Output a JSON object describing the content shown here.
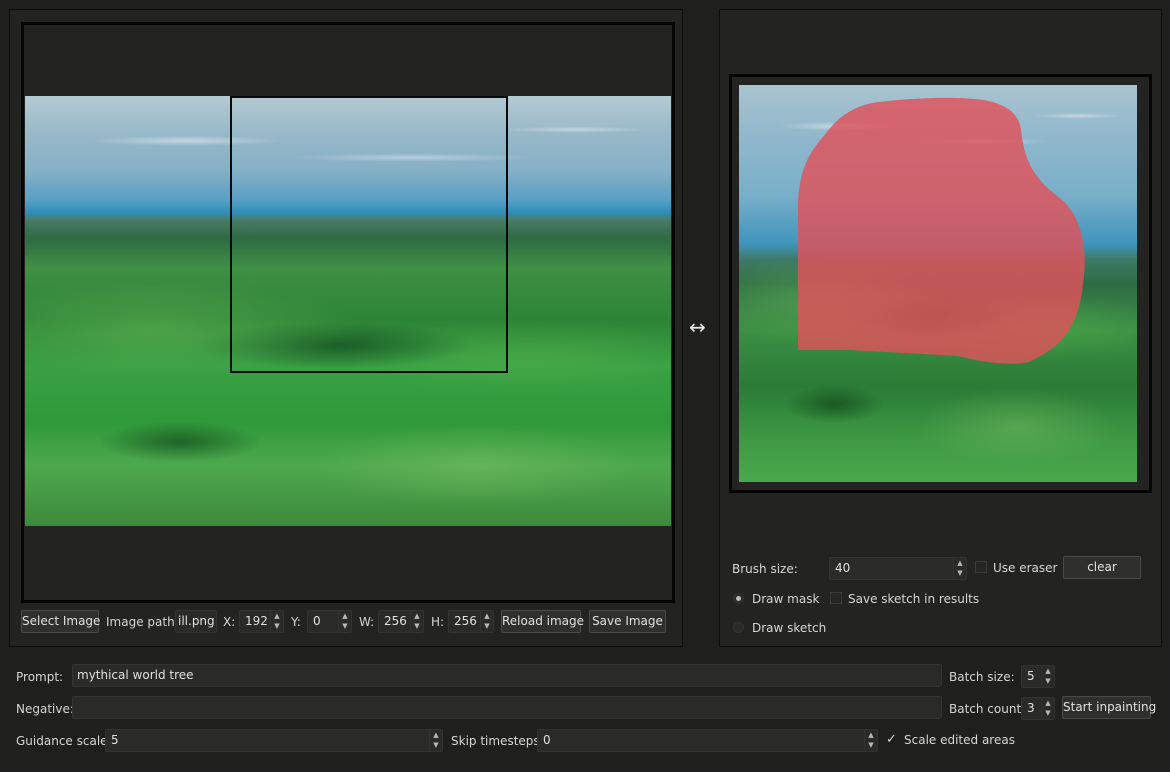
{
  "source_panel": {
    "select_image_label": "Select Image",
    "image_path_label": "Image path:",
    "image_path_value": "ill.png",
    "x_label": "X:",
    "x_value": "192",
    "y_label": "Y:",
    "y_value": "0",
    "w_label": "W:",
    "w_value": "256",
    "h_label": "H:",
    "h_value": "256",
    "reload_label": "Reload image",
    "save_label": "Save Image"
  },
  "swap_symbol": "↔",
  "mask_panel": {
    "brush_size_label": "Brush size:",
    "brush_size_value": "40",
    "use_eraser_label": "Use eraser",
    "clear_label": "clear",
    "draw_mask_label": "Draw mask",
    "save_sketch_label": "Save sketch in results",
    "draw_sketch_label": "Draw sketch",
    "mask_color": "#e0525a"
  },
  "controls": {
    "prompt_label": "Prompt:",
    "prompt_value": "mythical world tree",
    "negative_label": "Negative:",
    "negative_value": "",
    "batch_size_label": "Batch size:",
    "batch_size_value": "5",
    "batch_count_label": "Batch count:",
    "batch_count_value": "3",
    "start_label": "Start inpainting",
    "guidance_label": "Guidance scale:",
    "guidance_value": "5",
    "skip_label": "Skip timesteps:",
    "skip_value": "0",
    "scale_edited_label": "Scale edited areas",
    "check_symbol": "✓"
  }
}
